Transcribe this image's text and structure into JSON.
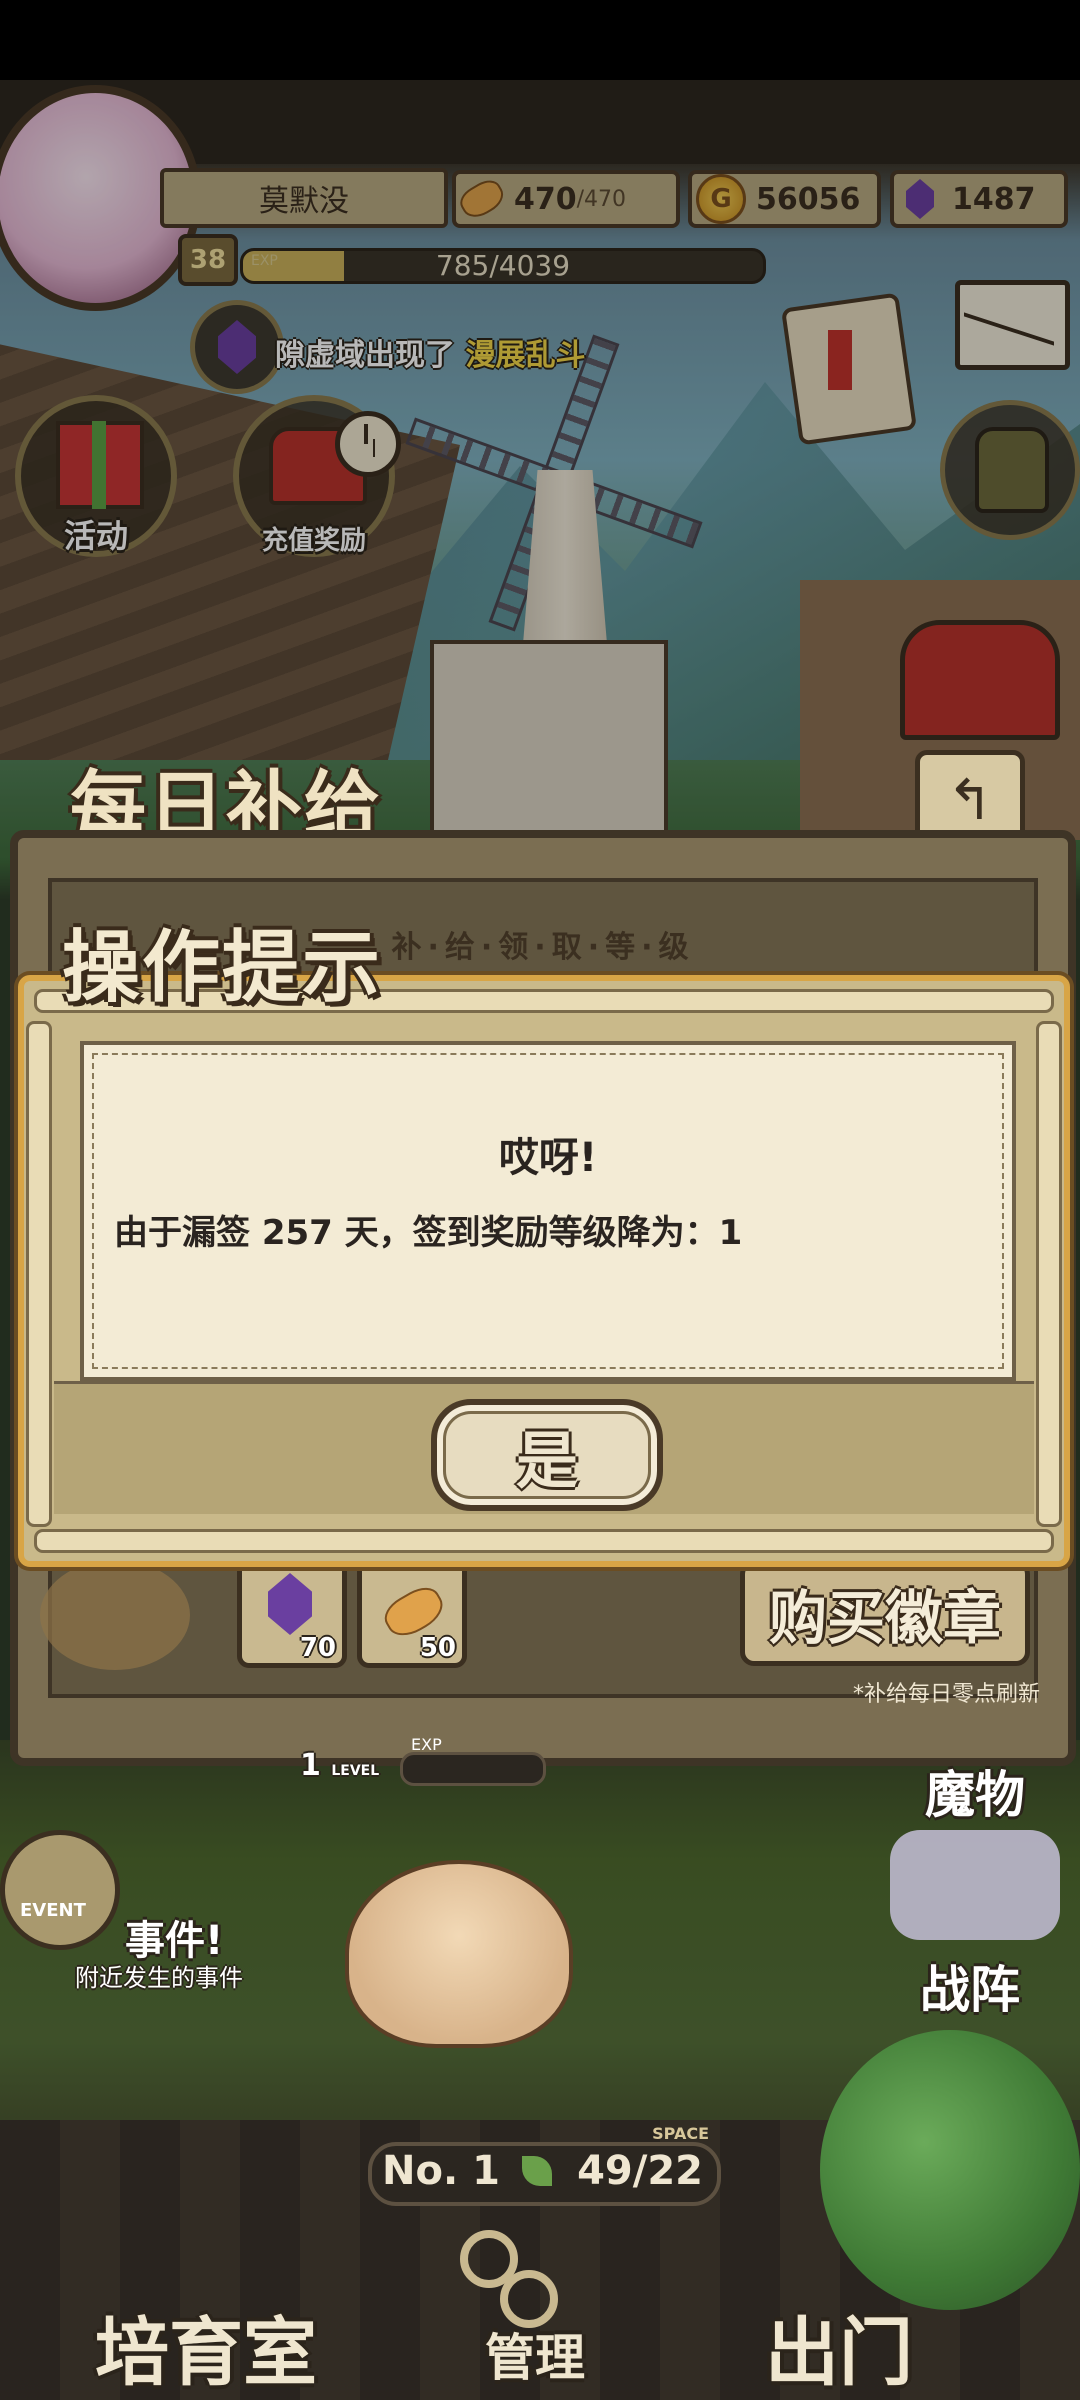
{
  "player": {
    "name": "莫默没",
    "level": "38",
    "exp_tag": "EXP",
    "exp_text": "785/4039",
    "exp_fraction": 0.194
  },
  "resources": {
    "stamina": "470",
    "stamina_max": "/470",
    "gold": "56056",
    "gems": "1487"
  },
  "news": {
    "prefix": "隙虚域出现了",
    "highlight": "漫展乱斗"
  },
  "hud_buttons": {
    "activity": "活动",
    "recharge": "充值奖励"
  },
  "daily_supply": {
    "title": "每日补给",
    "subtitle": "补·给·领·取·等·级",
    "items": [
      {
        "icon": "gem-icon",
        "count": "70"
      },
      {
        "icon": "bread-icon",
        "count": "50"
      }
    ],
    "buy_badge_label": "购买徽章",
    "refresh_note": "*补给每日零点刷新",
    "back_icon": "back-arrow-icon"
  },
  "dialog": {
    "title": "操作提示",
    "heading": "哎呀!",
    "message": "由于漏签 257 天，签到奖励等级降为：1",
    "confirm_label": "是"
  },
  "bottom_hud": {
    "monster_level": "1",
    "monster_level_tag": "LEVEL",
    "exp_tag": "EXP",
    "monster_label": "魔物",
    "formation_label": "战阵",
    "event_tag": "EVENT",
    "event_title": "事件!",
    "event_sub": "附近发生的事件",
    "rank": "No. 1",
    "space_tag": "SPACE",
    "space_value": "49/22",
    "nursery_label": "培育室",
    "manage_label": "管理",
    "exit_label": "出门"
  },
  "colors": {
    "panel": "#c9b98a",
    "dialog_border": "#d8a546",
    "highlight_text": "#f2d648"
  }
}
